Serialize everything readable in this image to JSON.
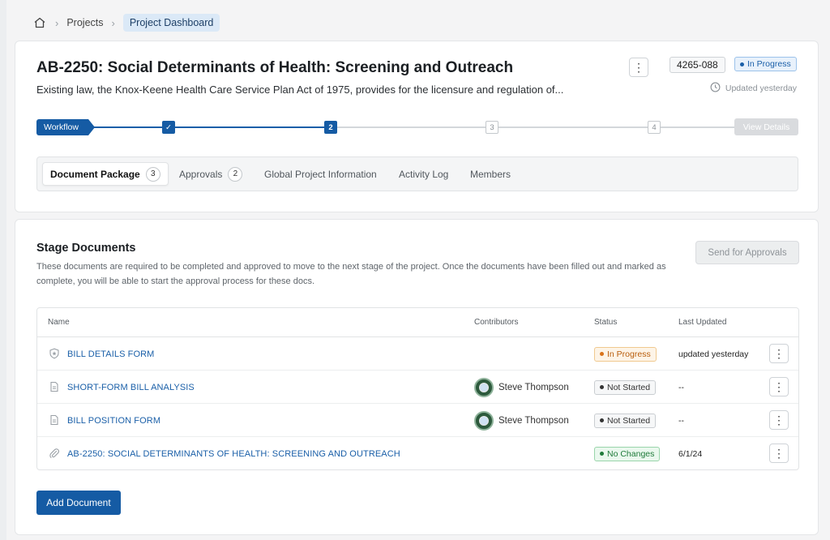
{
  "breadcrumb": {
    "home_icon": "home-icon",
    "items": [
      "Projects",
      "Project Dashboard"
    ]
  },
  "project": {
    "title": "AB-2250: Social Determinants of Health: Screening and Outreach",
    "description": "Existing law, the Knox-Keene Health Care Service Plan Act of 1975, provides for the licensure and regulation of...",
    "id": "4265-088",
    "status": "In Progress",
    "updated": "Updated yesterday"
  },
  "workflow": {
    "label": "Workflow",
    "steps": [
      "✓",
      "2",
      "3",
      "4"
    ],
    "view_details": "View Details"
  },
  "tabs": [
    {
      "label": "Document Package",
      "count": "3"
    },
    {
      "label": "Approvals",
      "count": "2"
    },
    {
      "label": "Global Project Information"
    },
    {
      "label": "Activity Log"
    },
    {
      "label": "Members"
    }
  ],
  "stage_documents": {
    "title": "Stage Documents",
    "description": "These documents are required to be completed and approved to move to the next stage of the project. Once the documents have been filled out and marked as complete, you will be able to start the approval process for these docs.",
    "send_button": "Send for Approvals",
    "columns": [
      "Name",
      "Contributors",
      "Status",
      "Last Updated"
    ],
    "rows": [
      {
        "icon": "shield-icon",
        "name": "BILL DETAILS FORM",
        "contributor": "",
        "status": "In Progress",
        "updated": "updated yesterday"
      },
      {
        "icon": "document-icon",
        "name": "SHORT-FORM BILL ANALYSIS",
        "contributor": "Steve Thompson",
        "status": "Not Started",
        "updated": "--"
      },
      {
        "icon": "document-icon",
        "name": "BILL POSITION FORM",
        "contributor": "Steve Thompson",
        "status": "Not Started",
        "updated": "--"
      },
      {
        "icon": "paperclip-icon",
        "name": "AB-2250: SOCIAL DETERMINANTS OF HEALTH: SCREENING AND OUTREACH",
        "contributor": "",
        "status": "No Changes",
        "updated": "6/1/24"
      }
    ],
    "add_button": "Add Document"
  },
  "colors": {
    "primary": "#155ba4",
    "link": "#1a5fa8",
    "in_progress": "#b85d0c",
    "no_changes": "#1f7a3a"
  }
}
